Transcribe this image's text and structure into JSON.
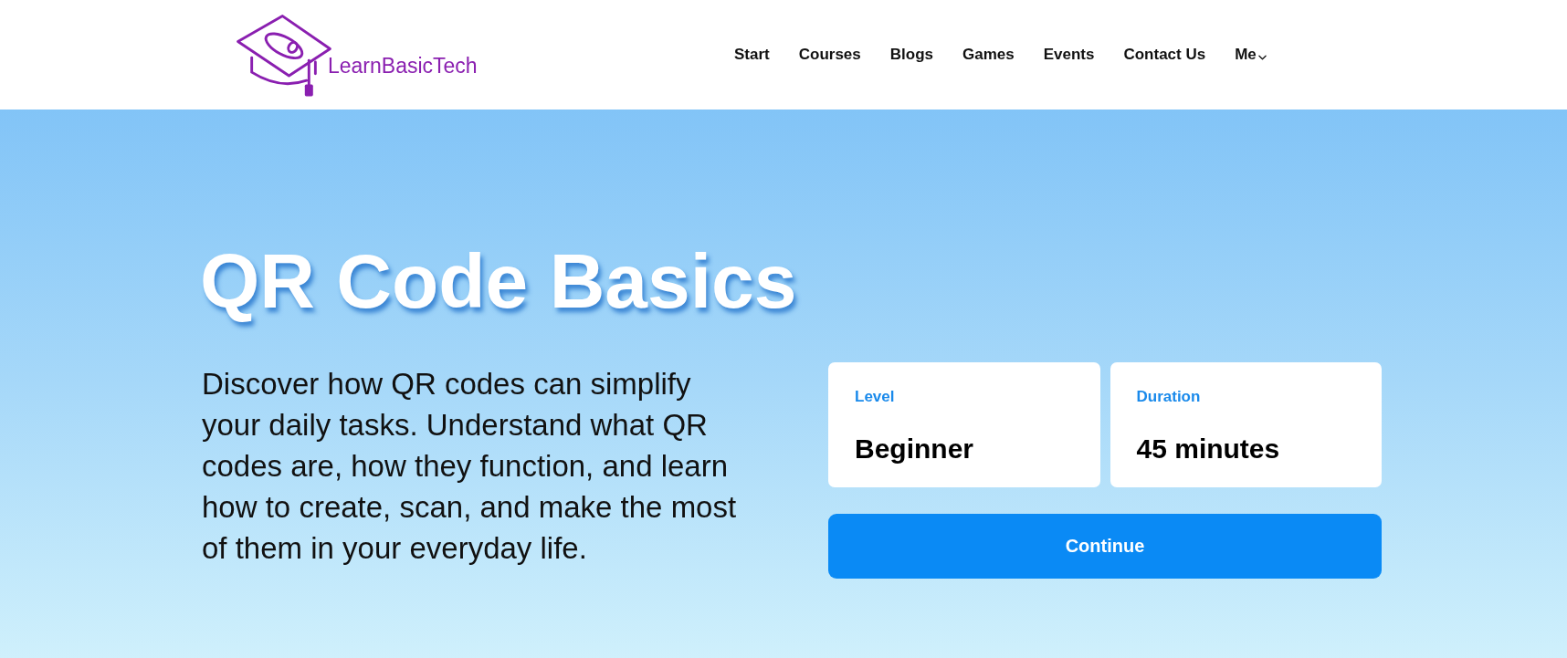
{
  "header": {
    "logo": {
      "text": "LearnBasicTech"
    },
    "nav": [
      {
        "label": "Start",
        "kind": "link"
      },
      {
        "label": "Courses",
        "kind": "link"
      },
      {
        "label": "Blogs",
        "kind": "link"
      },
      {
        "label": "Games",
        "kind": "link"
      },
      {
        "label": "Events",
        "kind": "link"
      },
      {
        "label": "Contact Us",
        "kind": "link"
      },
      {
        "label": "Me",
        "kind": "dropdown"
      }
    ]
  },
  "hero": {
    "title": "QR Code Basics",
    "description": "Discover how QR codes can simplify your daily tasks. Understand what QR codes are, how they function, and learn how to create, scan, and make the most of them in your everyday life.",
    "details": [
      {
        "label": "Level",
        "value": "Beginner"
      },
      {
        "label": "Duration",
        "value": "45 minutes"
      }
    ],
    "button": {
      "label": "Continue"
    }
  }
}
